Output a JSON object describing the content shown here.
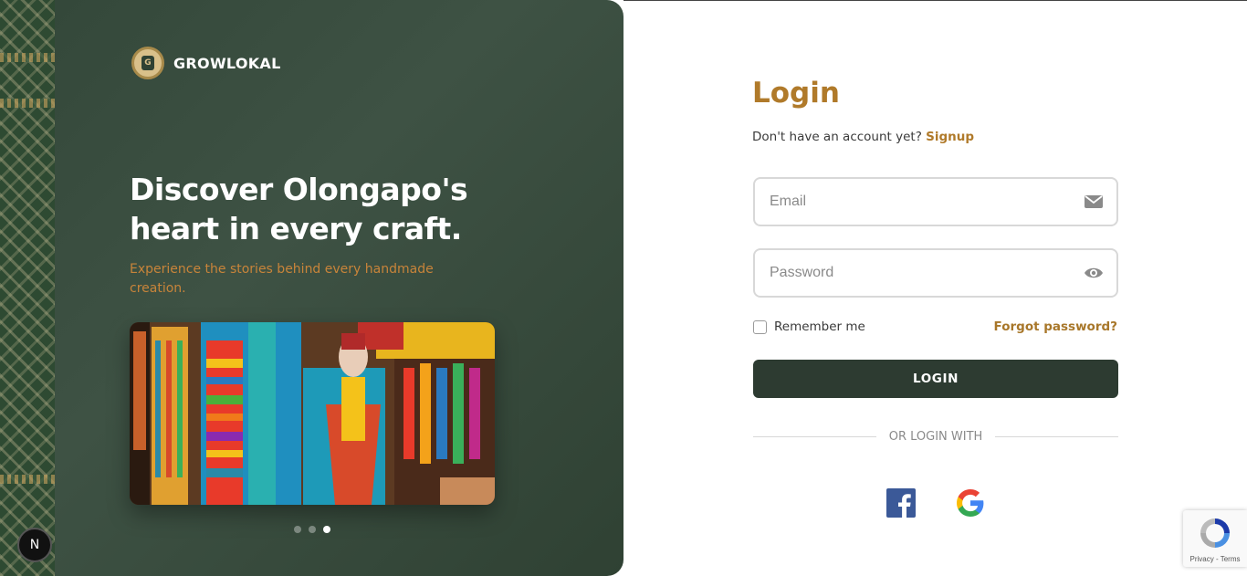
{
  "brand": {
    "name": "GROWLOKAL",
    "logo_letter": "G"
  },
  "hero": {
    "title": "Discover Olongapo's heart in every craft.",
    "subtitle": "Experience the stories behind every handmade creation.",
    "carousel": {
      "total": 3,
      "active_index": 3
    }
  },
  "login": {
    "title": "Login",
    "signup_prompt": "Don't have an account yet?",
    "signup_link": "Signup",
    "email_placeholder": "Email",
    "password_placeholder": "Password",
    "remember_label": "Remember me",
    "forgot_link": "Forgot password?",
    "submit_label": "LOGIN",
    "divider_text": "OR LOGIN WITH"
  },
  "social": {
    "facebook": "facebook-icon",
    "google": "google-icon"
  },
  "misc": {
    "next_badge": "N",
    "recaptcha_terms": "Privacy - Terms"
  },
  "colors": {
    "accent": "#b07a2a",
    "dark_green": "#2d3b31",
    "hero_bg": "#3a4c3e"
  }
}
